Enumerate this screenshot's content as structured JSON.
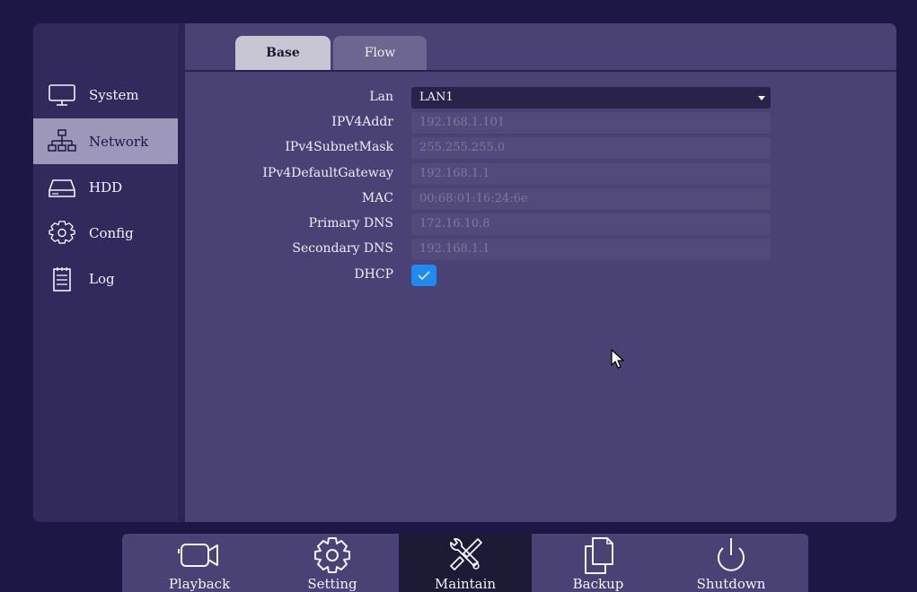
{
  "sidebar": {
    "items": [
      {
        "label": "System",
        "icon": "monitor-icon"
      },
      {
        "label": "Network",
        "icon": "network-icon"
      },
      {
        "label": "HDD",
        "icon": "hdd-icon"
      },
      {
        "label": "Config",
        "icon": "gear-icon"
      },
      {
        "label": "Log",
        "icon": "log-icon"
      }
    ],
    "active": "Network"
  },
  "tabs": [
    {
      "label": "Base",
      "active": true
    },
    {
      "label": "Flow",
      "active": false
    }
  ],
  "form": {
    "lan": {
      "label": "Lan",
      "value": "LAN1"
    },
    "ipv4addr": {
      "label": "IPV4Addr",
      "value": "192.168.1.101"
    },
    "subnet": {
      "label": "IPv4SubnetMask",
      "value": "255.255.255.0"
    },
    "gateway": {
      "label": "IPv4DefaultGateway",
      "value": "192.168.1.1"
    },
    "mac": {
      "label": "MAC",
      "value": "00:68:01:16:24:6e"
    },
    "primary_dns": {
      "label": "Primary DNS",
      "value": "172.16.10.8"
    },
    "secondary_dns": {
      "label": "Secondary DNS",
      "value": "192.168.1.1"
    },
    "dhcp": {
      "label": "DHCP",
      "checked": true
    }
  },
  "taskbar": {
    "items": [
      {
        "label": "Playback",
        "icon": "camera-icon"
      },
      {
        "label": "Setting",
        "icon": "gear-icon"
      },
      {
        "label": "Maintain",
        "icon": "tools-icon"
      },
      {
        "label": "Backup",
        "icon": "copy-icon"
      },
      {
        "label": "Shutdown",
        "icon": "power-icon"
      }
    ],
    "active": "Maintain"
  },
  "colors": {
    "background": "#1d1746",
    "panel": "#4a4275",
    "sidebar_active": "#9d98b9",
    "checkbox": "#1f8bf0"
  }
}
